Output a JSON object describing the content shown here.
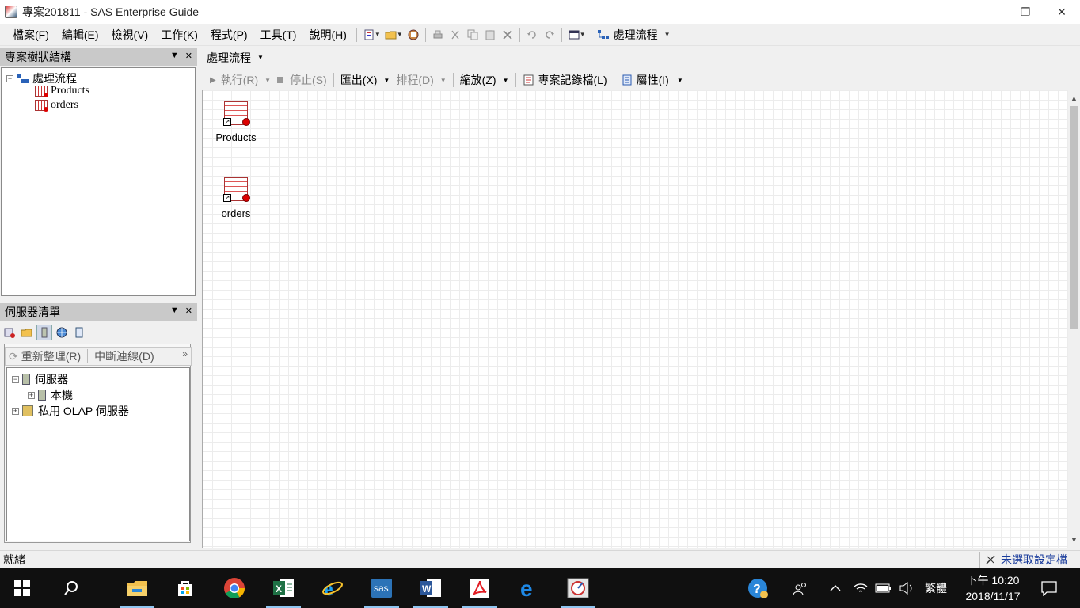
{
  "window": {
    "title": "專案201811 - SAS Enterprise Guide",
    "minimize": "—",
    "restore": "❐",
    "close": "✕"
  },
  "menu": [
    "檔案(F)",
    "編輯(E)",
    "檢視(V)",
    "工作(K)",
    "程式(P)",
    "工具(T)",
    "說明(H)"
  ],
  "toolbar": {
    "process_flow_label": "處理流程"
  },
  "project_tree": {
    "title": "專案樹狀結構",
    "root": "處理流程",
    "items": [
      "Products",
      "orders"
    ]
  },
  "server_list": {
    "title": "伺服器清單",
    "refresh": "重新整理(R)",
    "disconnect": "中斷連線(D)",
    "tree": {
      "root": "伺服器",
      "child": "本機",
      "olap": "私用 OLAP 伺服器"
    }
  },
  "main": {
    "header": "處理流程",
    "toolbar": {
      "run": "執行(R)",
      "stop": "停止(S)",
      "export": "匯出(X)",
      "schedule": "排程(D)",
      "zoom": "縮放(Z)",
      "log": "專案記錄檔(L)",
      "properties": "屬性(I)"
    },
    "nodes": [
      "Products",
      "orders"
    ]
  },
  "status": {
    "left": "就緒",
    "right": "未選取設定檔"
  },
  "taskbar": {
    "apps": [
      "file-explorer",
      "store",
      "chrome",
      "excel",
      "ie",
      "sas",
      "word",
      "acrobat",
      "edge",
      "sas-eg"
    ],
    "sas_text": "sas",
    "tray_lang": "繁體",
    "time": "下午 10:20",
    "date": "2018/11/17"
  }
}
